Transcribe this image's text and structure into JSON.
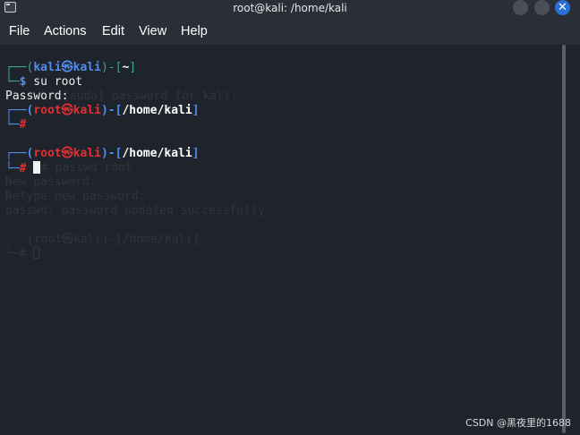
{
  "window": {
    "title": "root@kali: /home/kali",
    "close_glyph": "✕"
  },
  "menu": {
    "items": [
      "File",
      "Actions",
      "Edit",
      "View",
      "Help"
    ]
  },
  "terminal": {
    "box_top": "┌──",
    "box_bottom": "└─",
    "open_paren": "(",
    "close_paren": ")",
    "dash_bracket_open": "-[",
    "bracket_close": "]",
    "at_glyph": "㉿",
    "host": "kali",
    "prompt1": {
      "user": "kali",
      "path": "~",
      "symbol": "$",
      "command": " su root"
    },
    "password_line": "Password:",
    "prompt2": {
      "user": "root",
      "path": "/home/kali",
      "symbol": "#"
    },
    "prompt3": {
      "user": "root",
      "path": "/home/kali",
      "symbol": "#"
    },
    "ghost_lines": [
      "[sudo] password for kali:",
      "# passwd root",
      "New password:",
      "Retype new password:",
      "passwd: password updated successfully",
      "(root㉿kali)-[/home/kali]",
      "└─#"
    ]
  },
  "watermark": "CSDN @黑夜里的1688"
}
